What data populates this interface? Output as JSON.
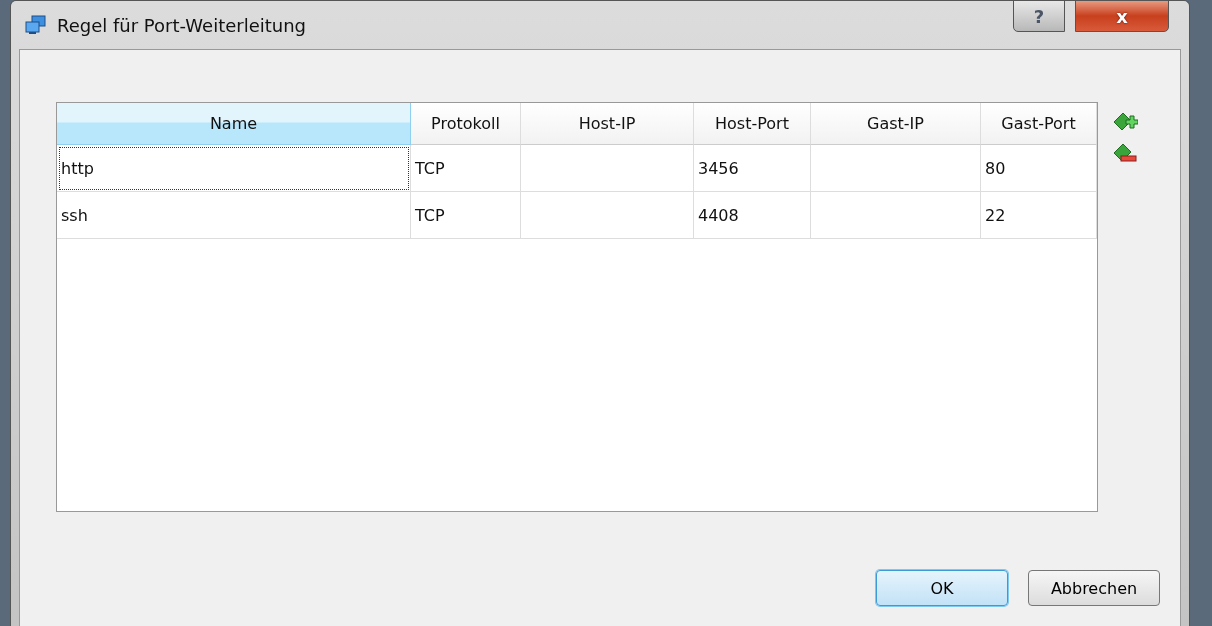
{
  "window": {
    "title": "Regel für Port-Weiterleitung",
    "help_button": "?",
    "close_button": "x"
  },
  "table": {
    "columns": [
      {
        "label": "Name",
        "selected": true
      },
      {
        "label": "Protokoll",
        "selected": false
      },
      {
        "label": "Host-IP",
        "selected": false
      },
      {
        "label": "Host-Port",
        "selected": false
      },
      {
        "label": "Gast-IP",
        "selected": false
      },
      {
        "label": "Gast-Port",
        "selected": false
      }
    ],
    "rows": [
      {
        "cells": [
          "http",
          "TCP",
          "",
          "3456",
          "",
          "80"
        ],
        "focused": true
      },
      {
        "cells": [
          "ssh",
          "TCP",
          "",
          "4408",
          "",
          "22"
        ],
        "focused": false
      }
    ]
  },
  "buttons": [
    {
      "label": "OK",
      "default": true
    },
    {
      "label": "Abbrechen",
      "default": false
    }
  ]
}
